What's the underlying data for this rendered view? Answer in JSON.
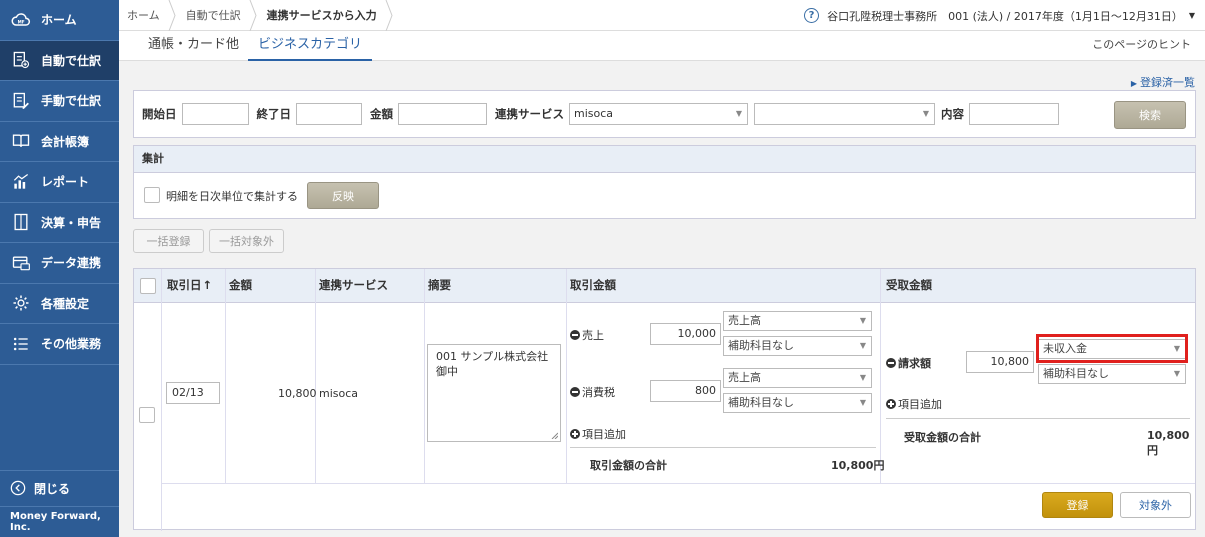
{
  "sidebar": {
    "items": [
      {
        "label": "ホーム",
        "icon": "cloud-logo-icon"
      },
      {
        "label": "自動で仕訳",
        "icon": "auto-journal-icon"
      },
      {
        "label": "手動で仕訳",
        "icon": "manual-journal-icon"
      },
      {
        "label": "会計帳簿",
        "icon": "book-icon"
      },
      {
        "label": "レポート",
        "icon": "chart-icon"
      },
      {
        "label": "決算・申告",
        "icon": "folder-icon"
      },
      {
        "label": "データ連携",
        "icon": "card-icon"
      },
      {
        "label": "各種設定",
        "icon": "gear-icon"
      },
      {
        "label": "その他業務",
        "icon": "list-icon"
      }
    ],
    "close_label": "閉じる",
    "footer": "Money Forward, Inc."
  },
  "header": {
    "breadcrumbs": [
      "ホーム",
      "自動で仕訳",
      "連携サービスから入力"
    ],
    "office": "谷口孔陞税理士事務所　001 (法人) / 2017年度（1月1日〜12月31日）"
  },
  "tabs": [
    "通帳・カード他",
    "ビジネスカテゴリ"
  ],
  "hint": "このページのヒント",
  "registered_link": "登録済一覧",
  "filter": {
    "start_label": "開始日",
    "end_label": "終了日",
    "amount_label": "金額",
    "service_label": "連携サービス",
    "service_value": "misoca",
    "content_label": "内容",
    "search_button": "検索"
  },
  "summary": {
    "title": "集計",
    "daily_label": "明細を日次単位で集計する",
    "apply_button": "反映"
  },
  "bulk": {
    "register": "一括登録",
    "exclude": "一括対象外"
  },
  "table": {
    "headers": [
      "取引日",
      "金額",
      "連携サービス",
      "摘要",
      "取引金額",
      "受取金額"
    ],
    "row": {
      "date": "02/13",
      "amount": "10,800",
      "service": "misoca",
      "memo_line1": "001 サンプル株式会社",
      "memo_line2": "御中",
      "sales_label": "売上",
      "sales_amount": "10,000",
      "sales_account": "売上高",
      "sales_sub": "補助科目なし",
      "tax_label": "消費税",
      "tax_amount": "800",
      "tax_account": "売上高",
      "tax_sub": "補助科目なし",
      "add_item": "項目追加",
      "total_label": "取引金額の合計",
      "total_value": "10,800円",
      "invoice_label": "請求額",
      "invoice_amount": "10,800",
      "recv_account": "未収入金",
      "recv_sub": "補助科目なし",
      "recv_add_item": "項目追加",
      "recv_total_label": "受取金額の合計",
      "recv_total_value": "10,800円",
      "register_button": "登録",
      "exclude_button": "対象外"
    }
  },
  "colors": {
    "sidebar": "#2d5c95",
    "accent": "#2a62a6",
    "highlight": "#e0201d",
    "gold": "#c9990f"
  }
}
